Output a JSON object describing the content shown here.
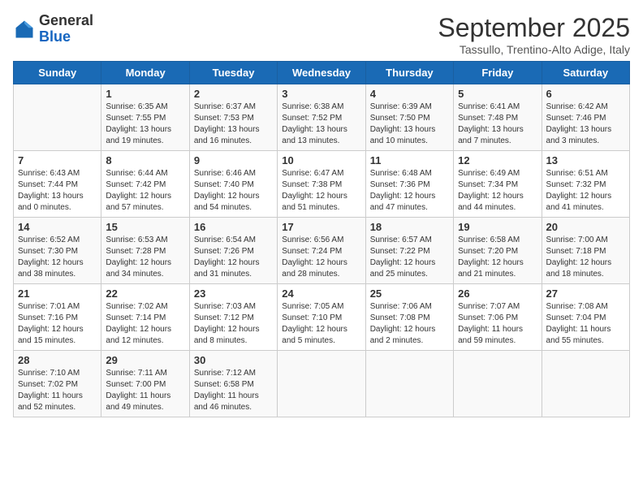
{
  "header": {
    "logo_general": "General",
    "logo_blue": "Blue",
    "month_title": "September 2025",
    "subtitle": "Tassullo, Trentino-Alto Adige, Italy"
  },
  "days_of_week": [
    "Sunday",
    "Monday",
    "Tuesday",
    "Wednesday",
    "Thursday",
    "Friday",
    "Saturday"
  ],
  "weeks": [
    [
      {
        "day": "",
        "info": ""
      },
      {
        "day": "1",
        "info": "Sunrise: 6:35 AM\nSunset: 7:55 PM\nDaylight: 13 hours\nand 19 minutes."
      },
      {
        "day": "2",
        "info": "Sunrise: 6:37 AM\nSunset: 7:53 PM\nDaylight: 13 hours\nand 16 minutes."
      },
      {
        "day": "3",
        "info": "Sunrise: 6:38 AM\nSunset: 7:52 PM\nDaylight: 13 hours\nand 13 minutes."
      },
      {
        "day": "4",
        "info": "Sunrise: 6:39 AM\nSunset: 7:50 PM\nDaylight: 13 hours\nand 10 minutes."
      },
      {
        "day": "5",
        "info": "Sunrise: 6:41 AM\nSunset: 7:48 PM\nDaylight: 13 hours\nand 7 minutes."
      },
      {
        "day": "6",
        "info": "Sunrise: 6:42 AM\nSunset: 7:46 PM\nDaylight: 13 hours\nand 3 minutes."
      }
    ],
    [
      {
        "day": "7",
        "info": "Sunrise: 6:43 AM\nSunset: 7:44 PM\nDaylight: 13 hours\nand 0 minutes."
      },
      {
        "day": "8",
        "info": "Sunrise: 6:44 AM\nSunset: 7:42 PM\nDaylight: 12 hours\nand 57 minutes."
      },
      {
        "day": "9",
        "info": "Sunrise: 6:46 AM\nSunset: 7:40 PM\nDaylight: 12 hours\nand 54 minutes."
      },
      {
        "day": "10",
        "info": "Sunrise: 6:47 AM\nSunset: 7:38 PM\nDaylight: 12 hours\nand 51 minutes."
      },
      {
        "day": "11",
        "info": "Sunrise: 6:48 AM\nSunset: 7:36 PM\nDaylight: 12 hours\nand 47 minutes."
      },
      {
        "day": "12",
        "info": "Sunrise: 6:49 AM\nSunset: 7:34 PM\nDaylight: 12 hours\nand 44 minutes."
      },
      {
        "day": "13",
        "info": "Sunrise: 6:51 AM\nSunset: 7:32 PM\nDaylight: 12 hours\nand 41 minutes."
      }
    ],
    [
      {
        "day": "14",
        "info": "Sunrise: 6:52 AM\nSunset: 7:30 PM\nDaylight: 12 hours\nand 38 minutes."
      },
      {
        "day": "15",
        "info": "Sunrise: 6:53 AM\nSunset: 7:28 PM\nDaylight: 12 hours\nand 34 minutes."
      },
      {
        "day": "16",
        "info": "Sunrise: 6:54 AM\nSunset: 7:26 PM\nDaylight: 12 hours\nand 31 minutes."
      },
      {
        "day": "17",
        "info": "Sunrise: 6:56 AM\nSunset: 7:24 PM\nDaylight: 12 hours\nand 28 minutes."
      },
      {
        "day": "18",
        "info": "Sunrise: 6:57 AM\nSunset: 7:22 PM\nDaylight: 12 hours\nand 25 minutes."
      },
      {
        "day": "19",
        "info": "Sunrise: 6:58 AM\nSunset: 7:20 PM\nDaylight: 12 hours\nand 21 minutes."
      },
      {
        "day": "20",
        "info": "Sunrise: 7:00 AM\nSunset: 7:18 PM\nDaylight: 12 hours\nand 18 minutes."
      }
    ],
    [
      {
        "day": "21",
        "info": "Sunrise: 7:01 AM\nSunset: 7:16 PM\nDaylight: 12 hours\nand 15 minutes."
      },
      {
        "day": "22",
        "info": "Sunrise: 7:02 AM\nSunset: 7:14 PM\nDaylight: 12 hours\nand 12 minutes."
      },
      {
        "day": "23",
        "info": "Sunrise: 7:03 AM\nSunset: 7:12 PM\nDaylight: 12 hours\nand 8 minutes."
      },
      {
        "day": "24",
        "info": "Sunrise: 7:05 AM\nSunset: 7:10 PM\nDaylight: 12 hours\nand 5 minutes."
      },
      {
        "day": "25",
        "info": "Sunrise: 7:06 AM\nSunset: 7:08 PM\nDaylight: 12 hours\nand 2 minutes."
      },
      {
        "day": "26",
        "info": "Sunrise: 7:07 AM\nSunset: 7:06 PM\nDaylight: 11 hours\nand 59 minutes."
      },
      {
        "day": "27",
        "info": "Sunrise: 7:08 AM\nSunset: 7:04 PM\nDaylight: 11 hours\nand 55 minutes."
      }
    ],
    [
      {
        "day": "28",
        "info": "Sunrise: 7:10 AM\nSunset: 7:02 PM\nDaylight: 11 hours\nand 52 minutes."
      },
      {
        "day": "29",
        "info": "Sunrise: 7:11 AM\nSunset: 7:00 PM\nDaylight: 11 hours\nand 49 minutes."
      },
      {
        "day": "30",
        "info": "Sunrise: 7:12 AM\nSunset: 6:58 PM\nDaylight: 11 hours\nand 46 minutes."
      },
      {
        "day": "",
        "info": ""
      },
      {
        "day": "",
        "info": ""
      },
      {
        "day": "",
        "info": ""
      },
      {
        "day": "",
        "info": ""
      }
    ]
  ]
}
